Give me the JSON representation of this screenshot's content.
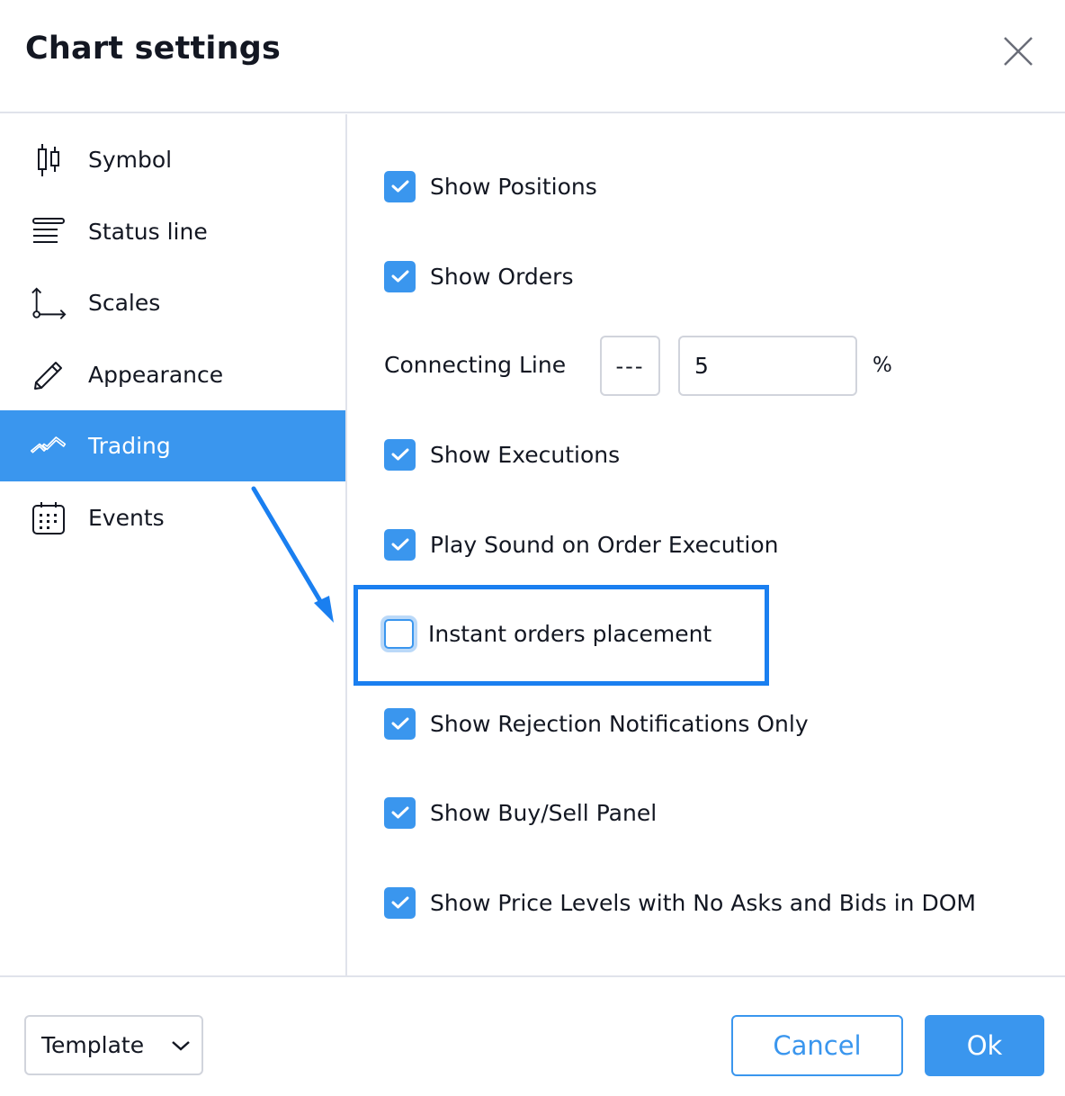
{
  "dialog": {
    "title": "Chart settings",
    "close_icon": "close-icon"
  },
  "sidebar": {
    "items": [
      {
        "label": "Symbol",
        "icon": "candlestick-icon",
        "active": false
      },
      {
        "label": "Status line",
        "icon": "status-line-icon",
        "active": false
      },
      {
        "label": "Scales",
        "icon": "scales-icon",
        "active": false
      },
      {
        "label": "Appearance",
        "icon": "pencil-icon",
        "active": false
      },
      {
        "label": "Trading",
        "icon": "trading-icon",
        "active": true
      },
      {
        "label": "Events",
        "icon": "calendar-icon",
        "active": false
      }
    ]
  },
  "trading": {
    "options": [
      {
        "label": "Show Positions",
        "checked": true
      },
      {
        "label": "Show Orders",
        "checked": true
      },
      {
        "label": "Show Executions",
        "checked": true
      },
      {
        "label": "Play Sound on Order Execution",
        "checked": true
      },
      {
        "label": "Instant orders placement",
        "checked": false
      },
      {
        "label": "Show Rejection Notifications Only",
        "checked": true
      },
      {
        "label": "Show Buy/Sell Panel",
        "checked": true
      },
      {
        "label": "Show Price Levels with No Asks and Bids in DOM",
        "checked": true
      }
    ],
    "connecting_line": {
      "label": "Connecting Line",
      "line_style": "---",
      "value": "5",
      "unit": "%"
    }
  },
  "footer": {
    "template_label": "Template",
    "cancel_label": "Cancel",
    "ok_label": "Ok"
  },
  "colors": {
    "accent": "#3a96ee",
    "annotation": "#1a7ff0",
    "text": "#131722",
    "border": "#d1d4dc"
  },
  "annotation": {
    "highlighted_option": "Instant orders placement"
  }
}
